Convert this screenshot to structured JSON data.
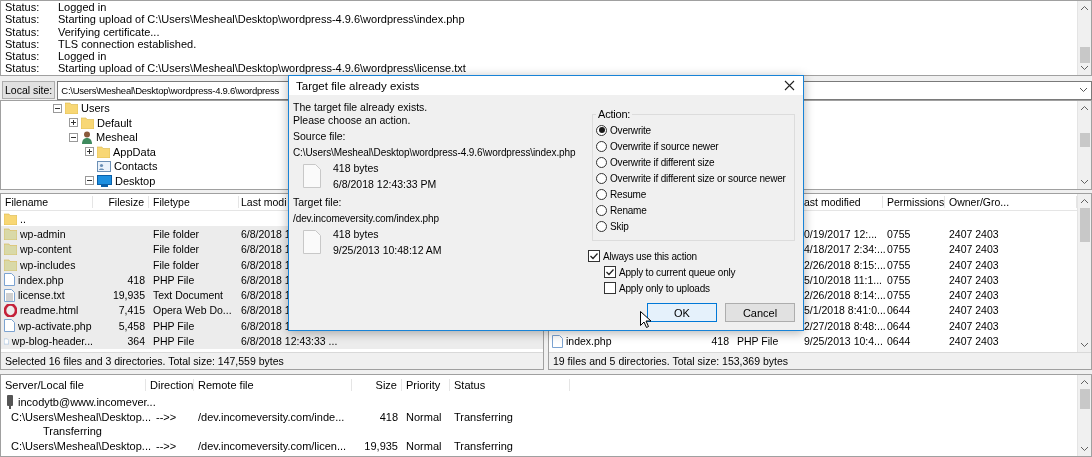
{
  "message_log": [
    {
      "label": "Status:",
      "text": "Logged in"
    },
    {
      "label": "Status:",
      "text": "Starting upload of C:\\Users\\Mesheal\\Desktop\\wordpress-4.9.6\\wordpress\\index.php"
    },
    {
      "label": "Status:",
      "text": "Verifying certificate..."
    },
    {
      "label": "Status:",
      "text": "TLS connection established."
    },
    {
      "label": "Status:",
      "text": "Logged in"
    },
    {
      "label": "Status:",
      "text": "Starting upload of C:\\Users\\Mesheal\\Desktop\\wordpress-4.9.6\\wordpress\\license.txt"
    }
  ],
  "local_site": {
    "label": "Local site:",
    "value": "C:\\Users\\Mesheal\\Desktop\\wordpress-4.9.6\\wordpress"
  },
  "local_tree": [
    {
      "label": "Users",
      "kind": "folder",
      "expanded": true,
      "children": [
        {
          "label": "Default",
          "kind": "folder",
          "expanded": false
        },
        {
          "label": "Mesheal",
          "kind": "user",
          "expanded": true,
          "children": [
            {
              "label": "AppData",
              "kind": "folder",
              "expanded": false
            },
            {
              "label": "Contacts",
              "kind": "contacts"
            },
            {
              "label": "Desktop",
              "kind": "desktop",
              "expanded": true
            }
          ]
        }
      ]
    }
  ],
  "local_files": {
    "columns": [
      "Filename",
      "Filesize",
      "Filetype",
      "Last modi"
    ],
    "rows": [
      {
        "kind": "folder",
        "name": "..",
        "size": "",
        "type": "",
        "modified": "",
        "selected": false
      },
      {
        "kind": "dir",
        "name": "wp-admin",
        "size": "",
        "type": "File folder",
        "modified": "6/8/2018 1",
        "selected": true
      },
      {
        "kind": "dir",
        "name": "wp-content",
        "size": "",
        "type": "File folder",
        "modified": "6/8/2018 1",
        "selected": true
      },
      {
        "kind": "dir",
        "name": "wp-includes",
        "size": "",
        "type": "File folder",
        "modified": "6/8/2018 1",
        "selected": true
      },
      {
        "kind": "php",
        "name": "index.php",
        "size": "418",
        "type": "PHP File",
        "modified": "6/8/2018 1",
        "selected": true
      },
      {
        "kind": "text",
        "name": "license.txt",
        "size": "19,935",
        "type": "Text Document",
        "modified": "6/8/2018 1",
        "selected": true
      },
      {
        "kind": "html",
        "name": "readme.html",
        "size": "7,415",
        "type": "Opera Web Do...",
        "modified": "6/8/2018 1",
        "selected": true
      },
      {
        "kind": "php",
        "name": "wp-activate.php",
        "size": "5,458",
        "type": "PHP File",
        "modified": "6/8/2018 1",
        "selected": true
      },
      {
        "kind": "php",
        "name": "wp-blog-header...",
        "size": "364",
        "type": "PHP File",
        "modified": "6/8/2018 12:43:33 ...",
        "selected": true
      }
    ],
    "status": "Selected 16 files and 3 directories. Total size: 147,559 bytes"
  },
  "remote_files": {
    "columns": [
      "",
      "",
      "",
      "ast modified",
      "Permissions",
      "Owner/Gro..."
    ],
    "rows": [
      {
        "kind": "none",
        "name": "",
        "size": "",
        "type": "",
        "modified": "0/19/2017 12:...",
        "permissions": "0755",
        "owner": "2407 2403"
      },
      {
        "kind": "none",
        "name": "",
        "size": "",
        "type": "",
        "modified": "4/18/2017 2:34:...",
        "permissions": "0755",
        "owner": "2407 2403"
      },
      {
        "kind": "none",
        "name": "",
        "size": "",
        "type": "",
        "modified": "2/26/2018 8:15:...",
        "permissions": "0755",
        "owner": "2407 2403"
      },
      {
        "kind": "none",
        "name": "",
        "size": "",
        "type": "",
        "modified": "5/10/2018 11:1...",
        "permissions": "0755",
        "owner": "2407 2403"
      },
      {
        "kind": "none",
        "name": "",
        "size": "",
        "type": "",
        "modified": "2/26/2018 8:14:...",
        "permissions": "0755",
        "owner": "2407 2403"
      },
      {
        "kind": "none",
        "name": "",
        "size": "",
        "type": "",
        "modified": "5/1/2018 8:41:0...",
        "permissions": "0644",
        "owner": "2407 2403"
      },
      {
        "kind": "none",
        "name": "",
        "size": "",
        "type": "",
        "modified": "2/27/2018 8:48:...",
        "permissions": "0644",
        "owner": "2407 2403"
      },
      {
        "kind": "php",
        "name": "index.php",
        "size": "418",
        "type": "PHP File",
        "modified": "9/25/2013 10:4...",
        "permissions": "0644",
        "owner": "2407 2403"
      }
    ],
    "status": "19 files and 5 directories. Total size: 153,369 bytes"
  },
  "queue": {
    "columns": [
      "Server/Local file",
      "Direction",
      "Remote file",
      "Size",
      "Priority",
      "Status"
    ],
    "rows": [
      {
        "kind": "server",
        "local": "incodytb@www.incomever..."
      },
      {
        "kind": "file",
        "local": "C:\\Users\\Mesheal\\Desktop...",
        "direction": "-->>",
        "remote": "/dev.incomeversity.com/inde...",
        "size": "418",
        "priority": "Normal",
        "status": "Transferring"
      },
      {
        "kind": "progress",
        "local": "Transferring"
      },
      {
        "kind": "file",
        "local": "C:\\Users\\Mesheal\\Desktop...",
        "direction": "-->>",
        "remote": "/dev.incomeversity.com/licen...",
        "size": "19,935",
        "priority": "Normal",
        "status": "Transferring"
      }
    ]
  },
  "dialog": {
    "title": "Target file already exists",
    "message": [
      "The target file already exists.",
      "Please choose an action."
    ],
    "source": {
      "label": "Source file:",
      "path": "C:\\Users\\Mesheal\\Desktop\\wordpress-4.9.6\\wordpress\\index.php",
      "size": "418 bytes",
      "date": "6/8/2018 12:43:33 PM"
    },
    "target": {
      "label": "Target file:",
      "path": "/dev.incomeversity.com/index.php",
      "size": "418 bytes",
      "date": "9/25/2013 10:48:12 AM"
    },
    "action_label": "Action:",
    "actions": [
      {
        "label": "Overwrite",
        "selected": true
      },
      {
        "label": "Overwrite if source newer",
        "selected": false
      },
      {
        "label": "Overwrite if different size",
        "selected": false
      },
      {
        "label": "Overwrite if different size or source newer",
        "selected": false
      },
      {
        "label": "Resume",
        "selected": false
      },
      {
        "label": "Rename",
        "selected": false
      },
      {
        "label": "Skip",
        "selected": false
      }
    ],
    "options": [
      {
        "label": "Always use this action",
        "checked": true,
        "indented": false
      },
      {
        "label": "Apply to current queue only",
        "checked": true,
        "indented": true
      },
      {
        "label": "Apply only to uploads",
        "checked": false,
        "indented": true
      }
    ],
    "buttons": [
      {
        "label": "OK",
        "default": true
      },
      {
        "label": "Cancel",
        "default": false
      }
    ]
  }
}
